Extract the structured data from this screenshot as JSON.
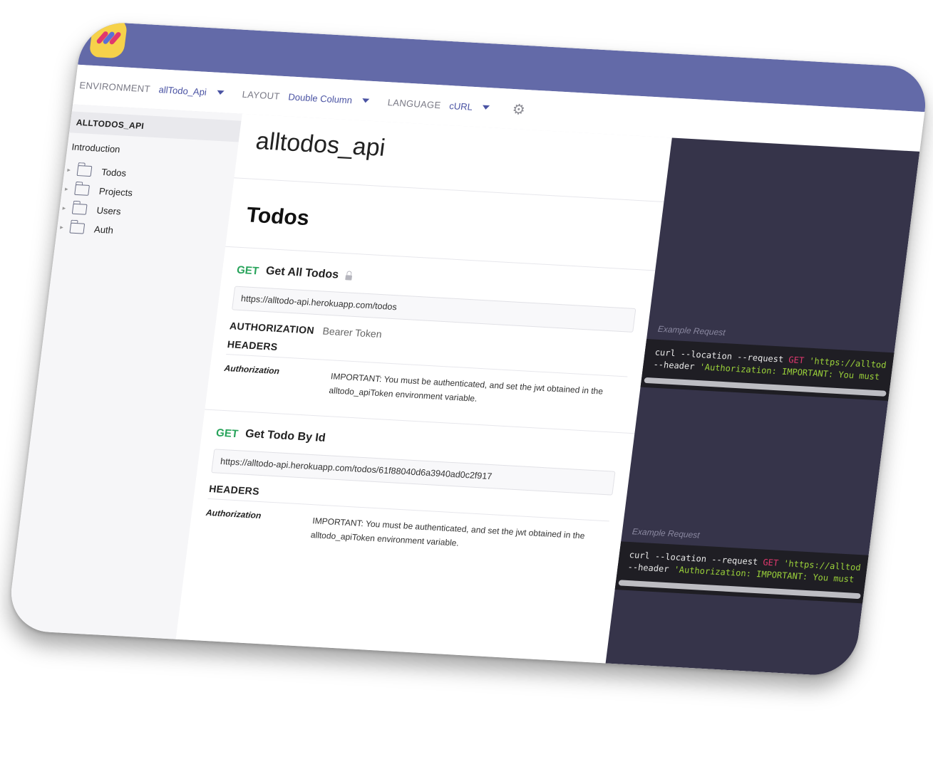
{
  "toolbar": {
    "environment_label": "ENVIRONMENT",
    "environment_value": "allTodo_Api",
    "layout_label": "LAYOUT",
    "layout_value": "Double Column",
    "language_label": "LANGUAGE",
    "language_value": "cURL"
  },
  "sidebar": {
    "title": "ALLTODOS_API",
    "intro": "Introduction",
    "items": [
      {
        "label": "Todos"
      },
      {
        "label": "Projects"
      },
      {
        "label": "Users"
      },
      {
        "label": "Auth"
      }
    ]
  },
  "main": {
    "doc_title": "alltodos_api",
    "section_title": "Todos",
    "requests": [
      {
        "method": "GET",
        "name": "Get All Todos",
        "url": "https://alltodo-api.herokuapp.com/todos",
        "auth_label": "AUTHORIZATION",
        "auth_value": "Bearer Token",
        "headers_label": "HEADERS",
        "header_key": "Authorization",
        "header_value": "IMPORTANT: You must be authenticated, and set the jwt obtained in the alltodo_apiToken environment variable."
      },
      {
        "method": "GET",
        "name": "Get Todo By Id",
        "url": "https://alltodo-api.herokuapp.com/todos/61f88040d6a3940ad0c2f917",
        "headers_label": "HEADERS",
        "header_key": "Authorization",
        "header_value": "IMPORTANT: You must be authenticated, and set the jwt obtained in the alltodo_apiToken environment variable."
      }
    ]
  },
  "examples": [
    {
      "label": "Example Request",
      "line1_a": "curl --location --request ",
      "line1_method": "GET",
      "line1_url": " 'https://alltod",
      "line2_a": "--header ",
      "line2_b": "'Authorization: IMPORTANT: You must"
    },
    {
      "label": "Example Request",
      "line1_a": "curl --location --request ",
      "line1_method": "GET",
      "line1_url": " 'https://alltod",
      "line2_a": "--header ",
      "line2_b": "'Authorization: IMPORTANT: You must"
    }
  ],
  "colors": {
    "topbar": "#636aa8",
    "get_method": "#27a35a",
    "code_panel": "#36344a"
  }
}
